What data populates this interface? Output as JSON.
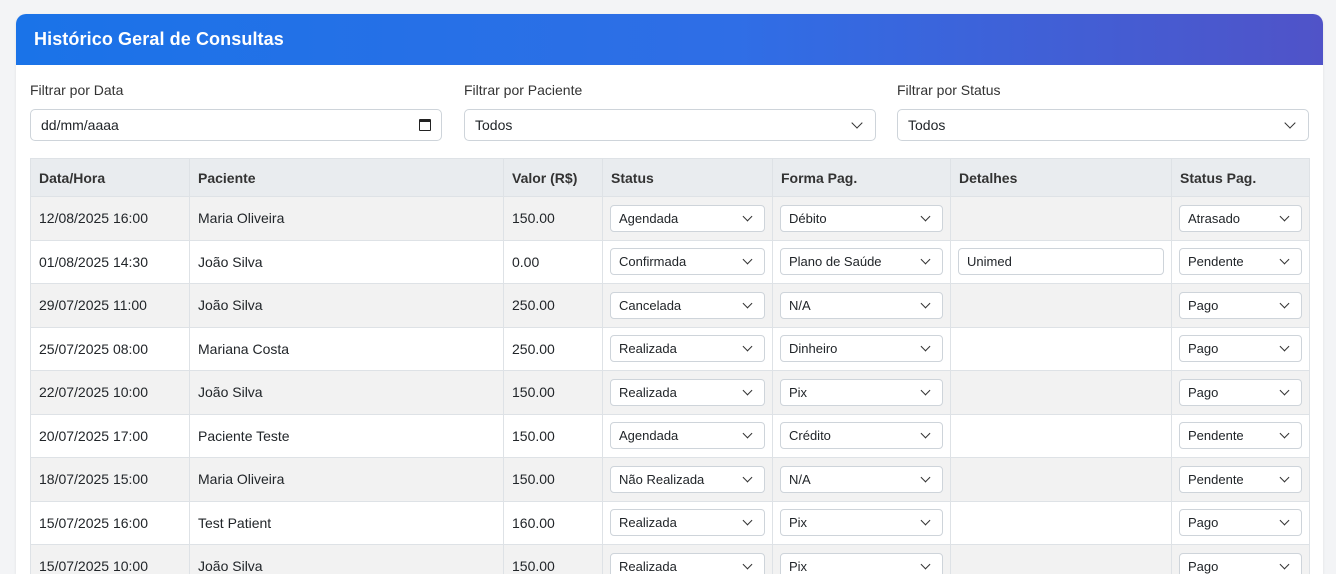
{
  "header": {
    "title": "Histórico Geral de Consultas"
  },
  "filters": {
    "date": {
      "label": "Filtrar por Data",
      "value": "dd/mm/aaaa"
    },
    "patient": {
      "label": "Filtrar por Paciente",
      "value": "Todos"
    },
    "status": {
      "label": "Filtrar por Status",
      "value": "Todos"
    }
  },
  "table": {
    "columns": [
      "Data/Hora",
      "Paciente",
      "Valor (R$)",
      "Status",
      "Forma Pag.",
      "Detalhes",
      "Status Pag."
    ],
    "rows": [
      {
        "datetime": "12/08/2025 16:00",
        "patient": "Maria Oliveira",
        "value": "150.00",
        "status": "Agendada",
        "payment": "Débito",
        "details": "",
        "pay_status": "Atrasado"
      },
      {
        "datetime": "01/08/2025 14:30",
        "patient": "João Silva",
        "value": "0.00",
        "status": "Confirmada",
        "payment": "Plano de Saúde",
        "details": "Unimed",
        "pay_status": "Pendente"
      },
      {
        "datetime": "29/07/2025 11:00",
        "patient": "João Silva",
        "value": "250.00",
        "status": "Cancelada",
        "payment": "N/A",
        "details": "",
        "pay_status": "Pago"
      },
      {
        "datetime": "25/07/2025 08:00",
        "patient": "Mariana Costa",
        "value": "250.00",
        "status": "Realizada",
        "payment": "Dinheiro",
        "details": "",
        "pay_status": "Pago"
      },
      {
        "datetime": "22/07/2025 10:00",
        "patient": "João Silva",
        "value": "150.00",
        "status": "Realizada",
        "payment": "Pix",
        "details": "",
        "pay_status": "Pago"
      },
      {
        "datetime": "20/07/2025 17:00",
        "patient": "Paciente Teste",
        "value": "150.00",
        "status": "Agendada",
        "payment": "Crédito",
        "details": "",
        "pay_status": "Pendente"
      },
      {
        "datetime": "18/07/2025 15:00",
        "patient": "Maria Oliveira",
        "value": "150.00",
        "status": "Não Realizada",
        "payment": "N/A",
        "details": "",
        "pay_status": "Pendente"
      },
      {
        "datetime": "15/07/2025 16:00",
        "patient": "Test Patient",
        "value": "160.00",
        "status": "Realizada",
        "payment": "Pix",
        "details": "",
        "pay_status": "Pago"
      },
      {
        "datetime": "15/07/2025 10:00",
        "patient": "João Silva",
        "value": "150.00",
        "status": "Realizada",
        "payment": "Pix",
        "details": "",
        "pay_status": "Pago"
      }
    ]
  }
}
